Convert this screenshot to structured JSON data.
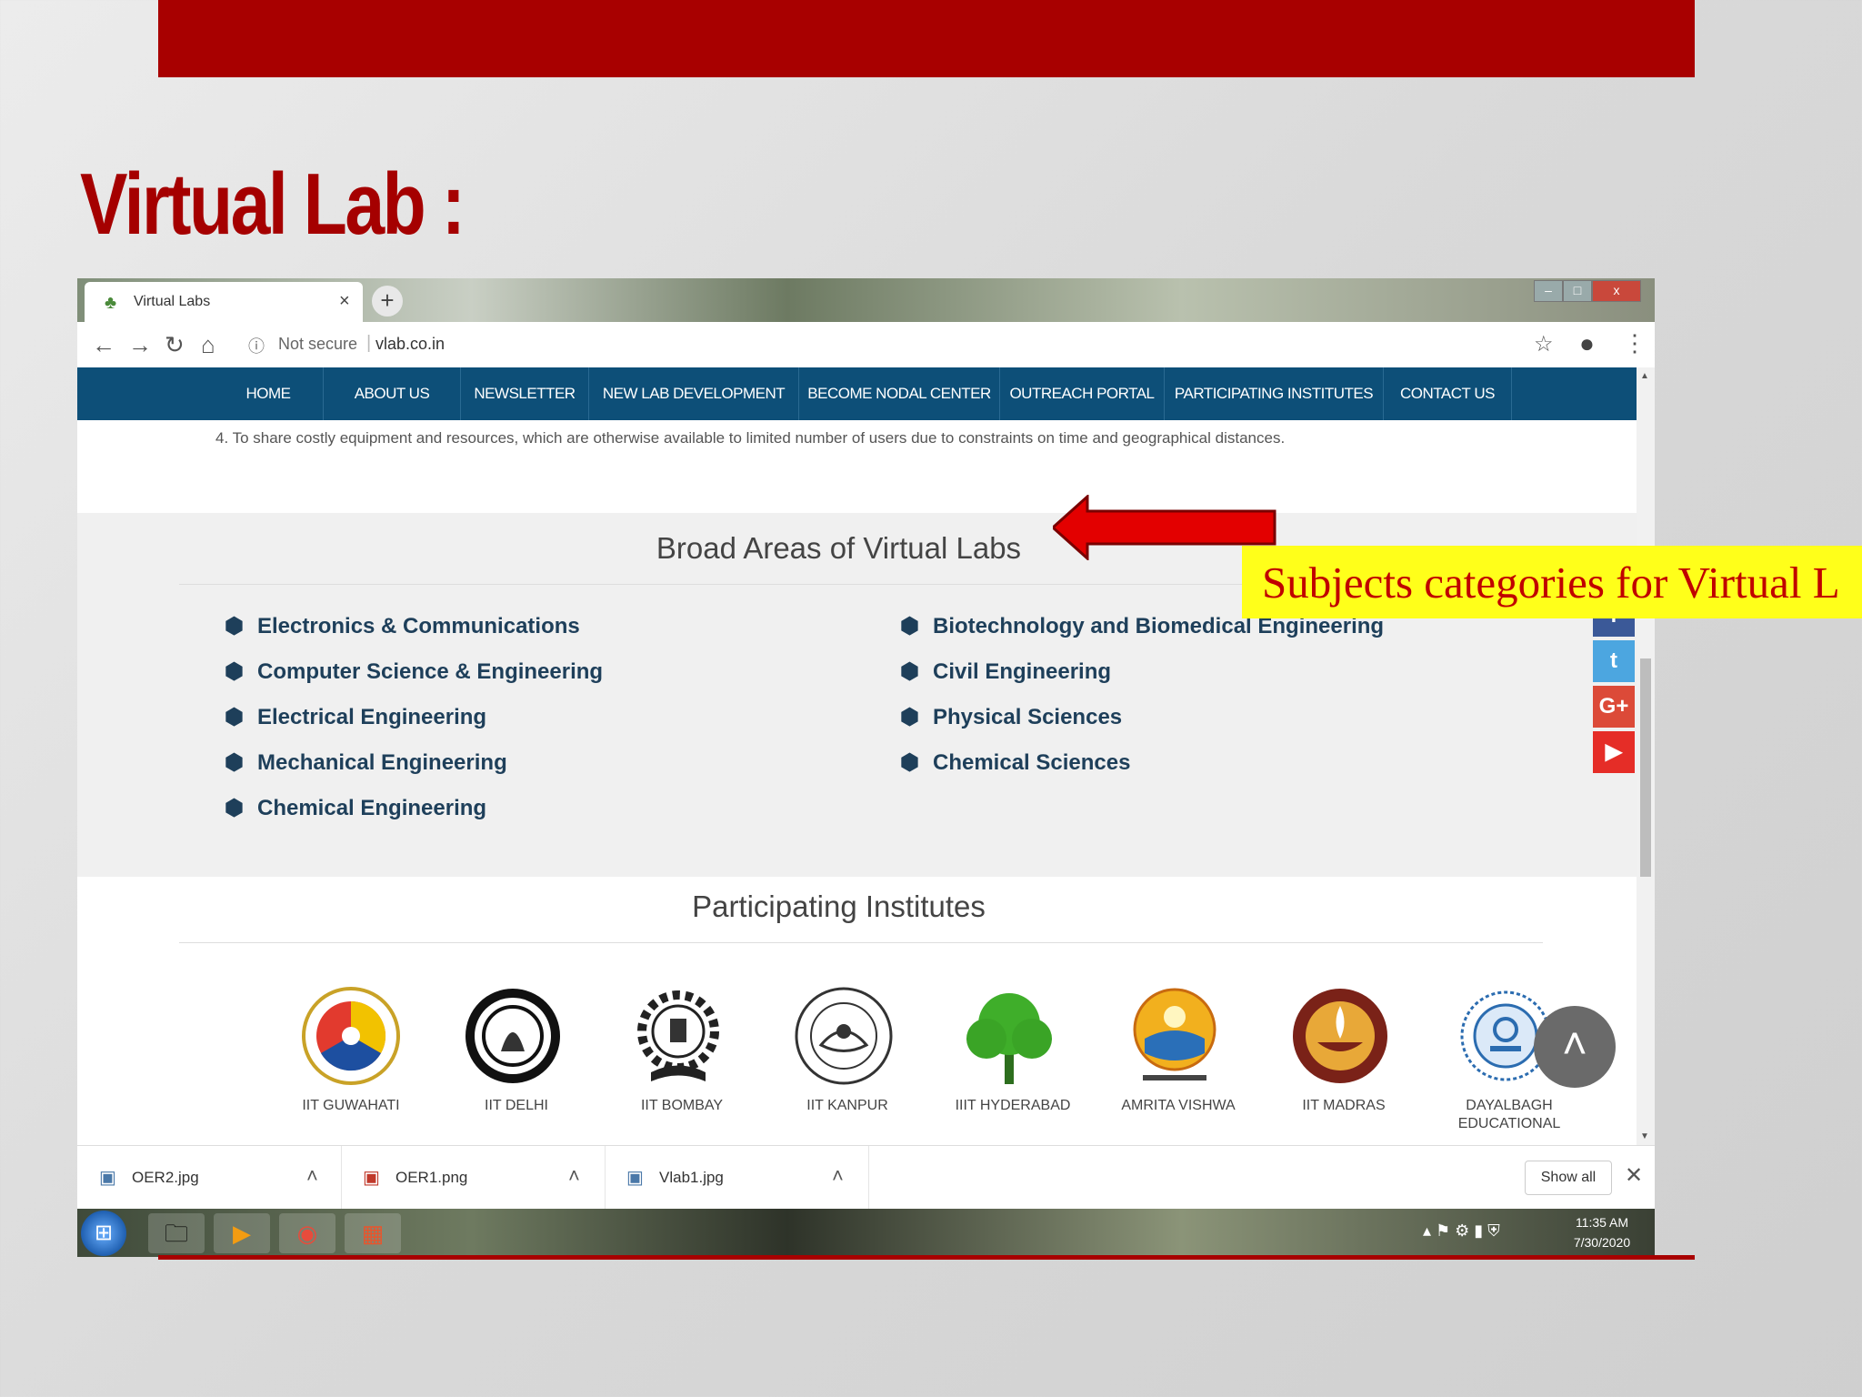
{
  "slide": {
    "title": "Virtual Lab :"
  },
  "browser": {
    "tab_title": "Virtual Labs",
    "tab_close": "×",
    "new_tab": "+",
    "window_controls": {
      "minimize": "–",
      "maximize": "□",
      "close": "x"
    },
    "security_label": "Not secure",
    "url": "vlab.co.in"
  },
  "site": {
    "nav": [
      "HOME",
      "ABOUT US",
      "NEWSLETTER",
      "NEW LAB DEVELOPMENT",
      "BECOME NODAL CENTER",
      "OUTREACH PORTAL",
      "PARTICIPATING INSTITUTES",
      "CONTACT US"
    ],
    "intro_text": "4. To share costly equipment and resources, which are otherwise available to limited number of users due to constraints on time and geographical distances.",
    "areas_title": "Broad Areas of Virtual Labs",
    "areas_left": [
      "Electronics & Communications",
      "Computer Science & Engineering",
      "Electrical Engineering",
      "Mechanical Engineering",
      "Chemical Engineering"
    ],
    "areas_right": [
      "Biotechnology and Biomedical Engineering",
      "Civil Engineering",
      "Physical Sciences",
      "Chemical Sciences"
    ],
    "institutes_title": "Participating Institutes",
    "institutes": [
      "IIT GUWAHATI",
      "IIT DELHI",
      "IIT BOMBAY",
      "IIT KANPUR",
      "IIIT HYDERABAD",
      "AMRITA VISHWA",
      "IIT MADRAS",
      "DAYALBAGH EDUCATIONAL"
    ],
    "social": [
      {
        "name": "facebook",
        "glyph": "f",
        "color": "#3b5998"
      },
      {
        "name": "twitter",
        "glyph": "t",
        "color": "#4ca6e0"
      },
      {
        "name": "google-plus",
        "glyph": "G+",
        "color": "#dc4a38"
      },
      {
        "name": "youtube",
        "glyph": "▶",
        "color": "#e52d27"
      }
    ]
  },
  "downloads": {
    "files": [
      "OER2.jpg",
      "OER1.png",
      "Vlab1.jpg"
    ],
    "show_all": "Show all",
    "close": "✕"
  },
  "taskbar": {
    "time": "11:35 AM",
    "date": "7/30/2020"
  },
  "annotation": {
    "callout": "Subjects categories for Virtual L"
  },
  "colors": {
    "brand_red": "#a80000",
    "nav_blue": "#0d4f78",
    "callout_yellow": "#ffff1a",
    "callout_text": "#c00000"
  }
}
